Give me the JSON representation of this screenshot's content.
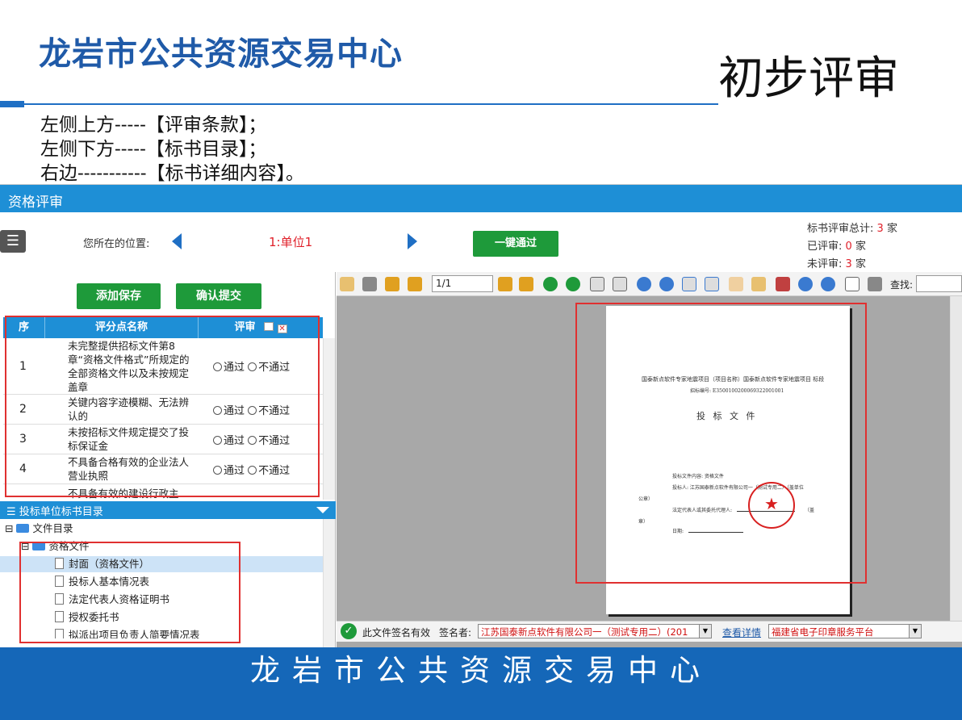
{
  "slide": {
    "title": "龙岩市公共资源交易中心",
    "label": "初步评审",
    "notes": [
      "左侧上方-----【评审条款】；",
      "左侧下方-----【标书目录】；",
      "右边-----------【标书详细内容】。"
    ],
    "footer": "龙岩市公共资源交易中心"
  },
  "app": {
    "header_title": "资格评审",
    "location_label": "您所在的位置:",
    "unit_name": "1:单位1",
    "pass_all_label": "一键通过",
    "stats": {
      "total_label": "标书评审总计:",
      "total_value": "3",
      "reviewed_label": "已评审:",
      "reviewed_value": "0",
      "unreviewed_label": "未评审:",
      "unreviewed_value": "3",
      "unit": "家"
    },
    "buttons": {
      "save": "添加保存",
      "submit": "确认提交"
    },
    "grid": {
      "headers": [
        "序",
        "评分点名称",
        "评审"
      ],
      "rows": [
        {
          "no": "1",
          "name": "未完整提供招标文件第8章“资格文件格式”所规定的全部资格文件以及未按规定盖章",
          "pass": "通过",
          "fail": "不通过"
        },
        {
          "no": "2",
          "name": "关键内容字迹模糊、无法辨认的",
          "pass": "通过",
          "fail": "不通过"
        },
        {
          "no": "3",
          "name": "未按招标文件规定提交了投标保证金",
          "pass": "通过",
          "fail": "不通过"
        },
        {
          "no": "4",
          "name": "不具备合格有效的企业法人营业执照",
          "pass": "通过",
          "fail": "不通过"
        },
        {
          "no": "",
          "name": "不具备有效的建设行政主",
          "pass": "",
          "fail": ""
        }
      ]
    },
    "tree": {
      "title": "投标单位标书目录",
      "root": "文件目录",
      "folder": "资格文件",
      "items": [
        "封面（资格文件）",
        "投标人基本情况表",
        "法定代表人资格证明书",
        "授权委托书",
        "拟派出项目负责人简要情况表"
      ]
    },
    "viewer": {
      "page_value": "1/1",
      "find_label": "查找:",
      "pdf": {
        "line1": "国泰新点软件专家地震项目（项目名称）国泰新点软件专家地震项目 标段",
        "line2": "招标编号: E3500100200069322001001",
        "heading": "投 标 文 件",
        "content": "投标文件内容:  资格文件",
        "bidder": "投标人: 江苏国泰新点软件有限公司一（测试专用二）（盖单位",
        "seal_suffix": "公章）",
        "legal": "法定代表人或其委托代理人:",
        "sign_suffix": "（盖",
        "chapter": "章）",
        "date": "日期:"
      }
    },
    "signature": {
      "status": "此文件签名有效",
      "signer_label": "签名者:",
      "signer_value": "江苏国泰新点软件有限公司一（测试专用二）(201",
      "detail_link": "查看详情",
      "platform": "福建省电子印章服务平台"
    }
  },
  "colors": {
    "brand_blue": "#1f5aa8",
    "header_blue": "#1e8fd6",
    "green": "#1e9a3a",
    "red": "#e03030",
    "footer_blue": "#1567b8"
  }
}
